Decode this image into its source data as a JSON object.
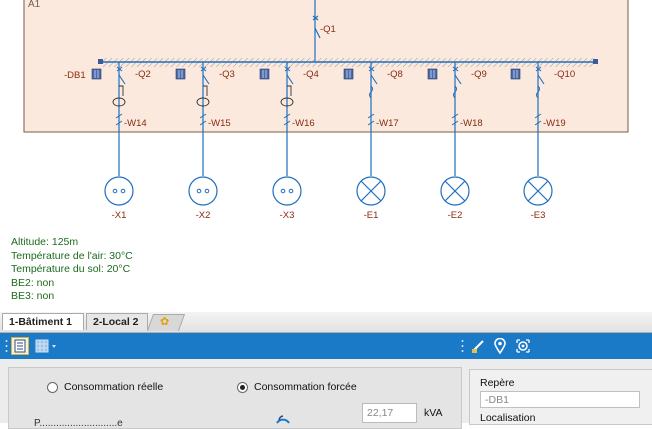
{
  "diagram": {
    "frame_label": "A1",
    "main_breaker": "-Q1",
    "busbar_label": "-DB1",
    "feeders": [
      {
        "breaker": "-Q2",
        "cable": "-W14",
        "load": "-X1",
        "load_type": "socket"
      },
      {
        "breaker": "-Q3",
        "cable": "-W15",
        "load": "-X2",
        "load_type": "socket"
      },
      {
        "breaker": "-Q4",
        "cable": "-W16",
        "load": "-X3",
        "load_type": "socket"
      },
      {
        "breaker": "-Q8",
        "cable": "-W17",
        "load": "-E1",
        "load_type": "lamp"
      },
      {
        "breaker": "-Q9",
        "cable": "-W18",
        "load": "-E2",
        "load_type": "lamp"
      },
      {
        "breaker": "-Q10",
        "cable": "-W19",
        "load": "-E3",
        "load_type": "lamp"
      }
    ],
    "colors": {
      "frame_fill": "#fbe9de",
      "frame_border": "#7a5a4a",
      "wire": "#1f6fbf",
      "label": "#8a2a10",
      "busbar": "#8a8a8a"
    }
  },
  "info": {
    "lines": [
      "Altitude: 125m",
      "Température de l'air: 30°C",
      "Température du sol: 20°C",
      "BE2: non",
      "BE3: non"
    ]
  },
  "tabs": [
    {
      "label": "1-Bâtiment 1",
      "active": true
    },
    {
      "label": "2-Local 2",
      "active": false
    }
  ],
  "toolbar": {
    "left_icons": [
      "properties-icon",
      "grid-dropdown-icon"
    ],
    "right_icons": [
      "brush-icon",
      "location-pin-icon",
      "target-icon"
    ],
    "color": "#1a7ac8"
  },
  "panel": {
    "radio_real": "Consommation réelle",
    "radio_forced": "Consommation forcée",
    "selected": "forced",
    "value": "22,17",
    "unit": "kVA",
    "cut_label": "P............................e",
    "repere_label": "Repère",
    "repere_value": "-DB1",
    "localisation_label": "Localisation"
  }
}
